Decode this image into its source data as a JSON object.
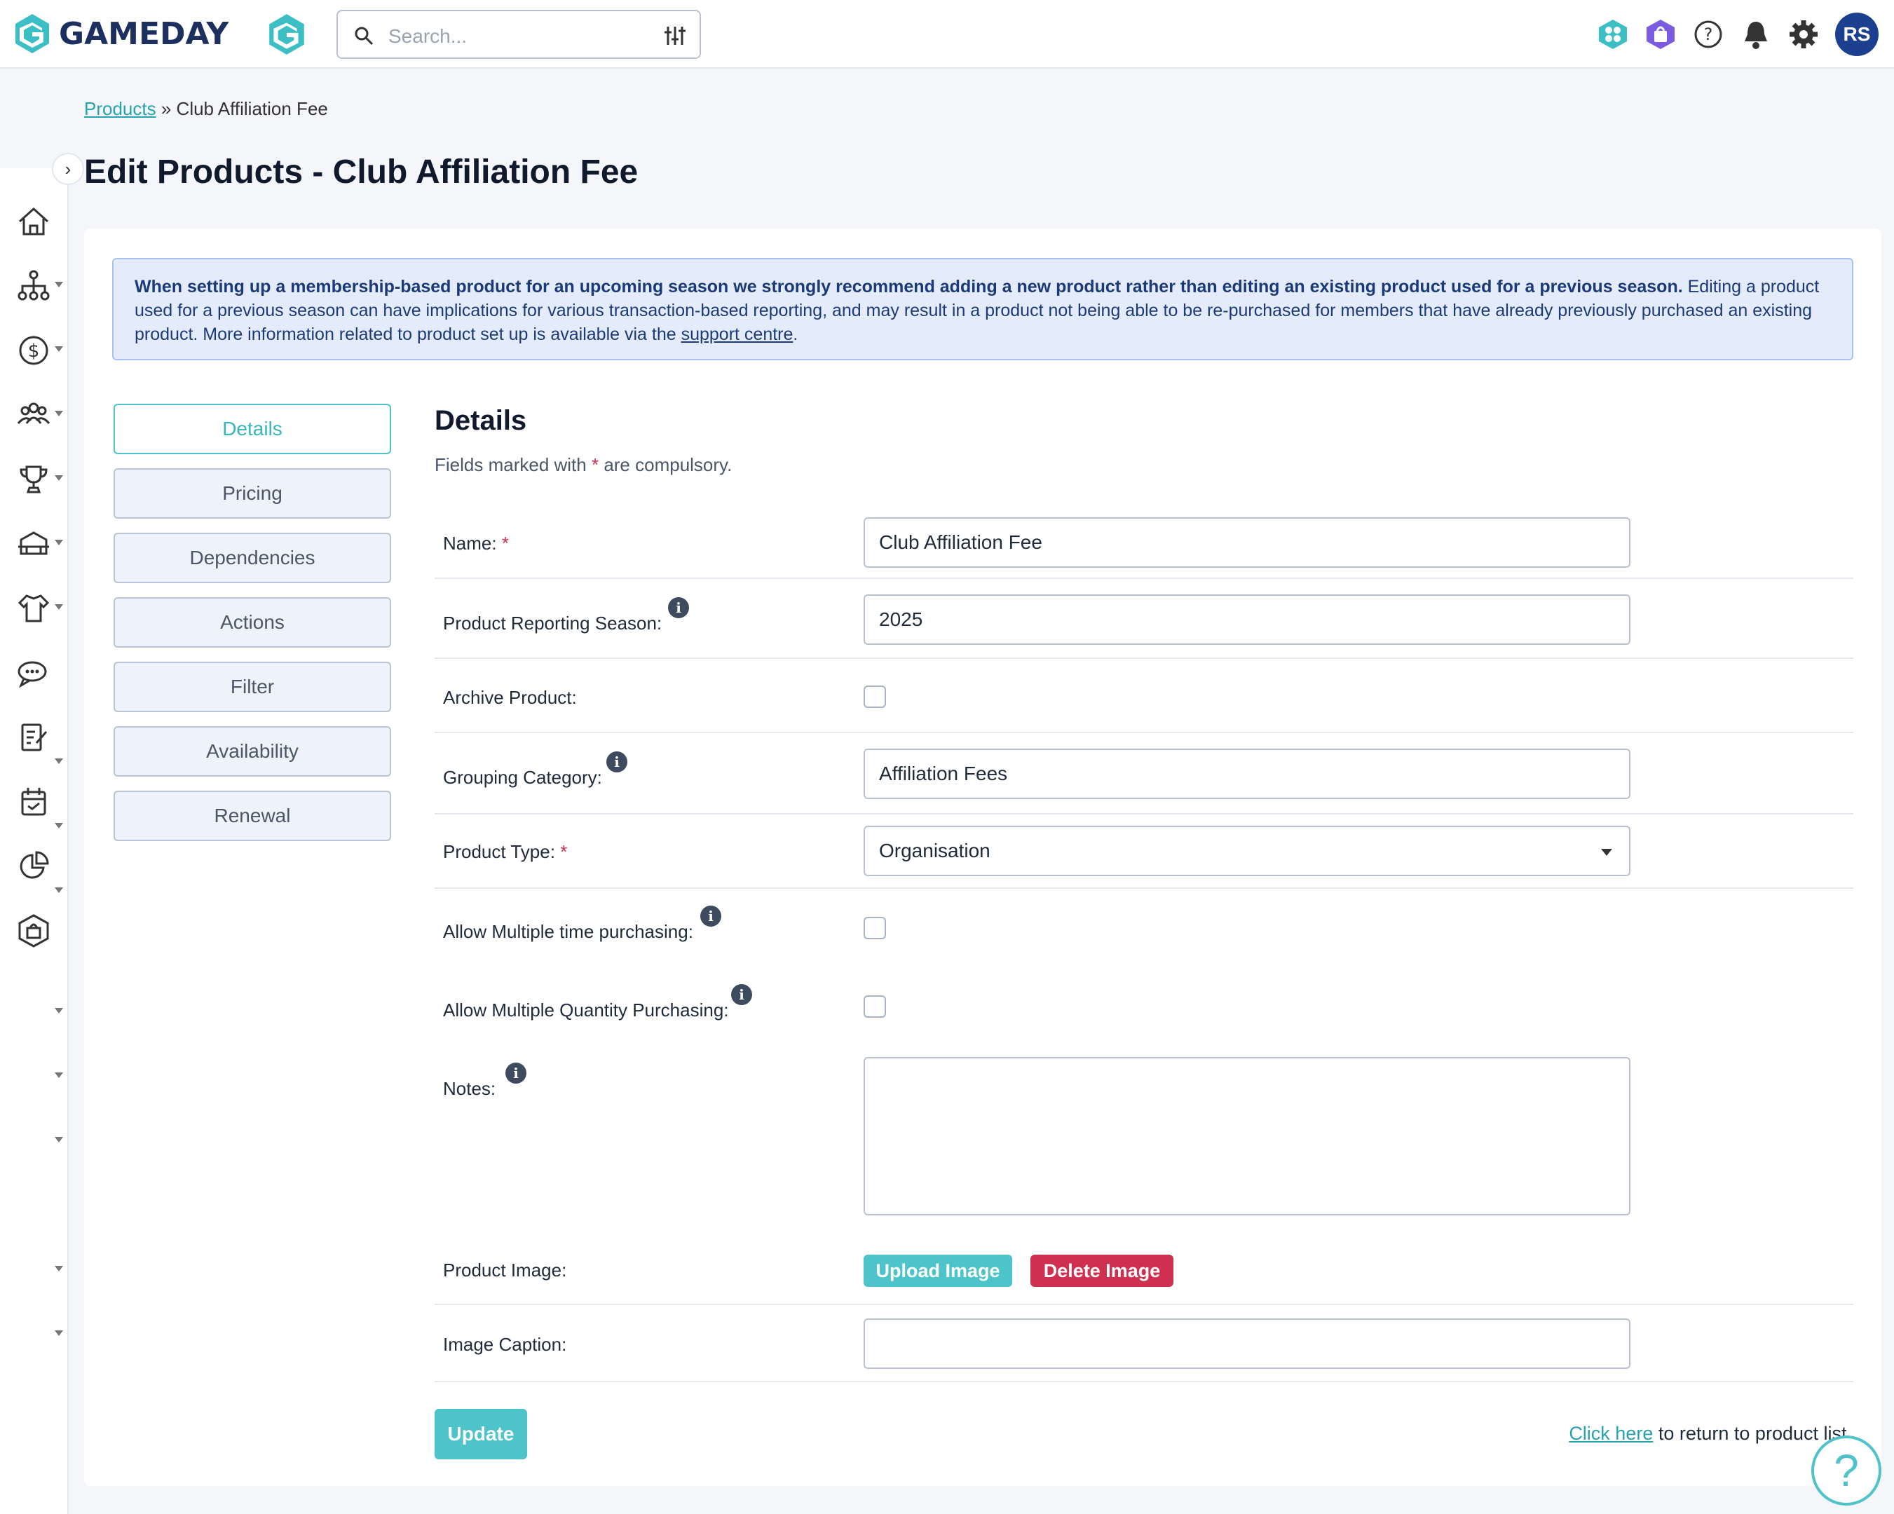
{
  "app": {
    "brand": "GAMEDAY"
  },
  "search": {
    "placeholder": "Search..."
  },
  "user": {
    "initials": "RS"
  },
  "colors": {
    "accent": "#4cc4c9",
    "brand": "#1d2f5e",
    "danger": "#d0304f",
    "alert_bg": "#e4ecfb"
  },
  "breadcrumb": {
    "parent": "Products",
    "separator": "»",
    "current": "Club Affiliation Fee"
  },
  "page": {
    "title": "Edit Products - Club Affiliation Fee"
  },
  "alert": {
    "bold": "When setting up a membership-based product for an upcoming season we strongly recommend adding a new product rather than editing an existing product used for a previous season.",
    "text": " Editing a product used for a previous season can have implications for various transaction-based reporting, and may result in a product not being able to be re-purchased for members that have already previously purchased an existing product. More information related to product set up is available via the ",
    "link": "support centre",
    "end": "."
  },
  "tabs": [
    {
      "label": "Details",
      "active": true
    },
    {
      "label": "Pricing"
    },
    {
      "label": "Dependencies"
    },
    {
      "label": "Actions"
    },
    {
      "label": "Filter"
    },
    {
      "label": "Availability"
    },
    {
      "label": "Renewal"
    }
  ],
  "form": {
    "title": "Details",
    "subtitle_pre": "Fields marked with ",
    "required_mark": "*",
    "subtitle_post": " are compulsory.",
    "name_label": "Name:",
    "name_value": "Club Affiliation Fee",
    "season_label": "Product Reporting Season:",
    "season_value": "2025",
    "archive_label": "Archive Product:",
    "grouping_label": "Grouping Category:",
    "grouping_value": "Affiliation Fees",
    "type_label": "Product Type:",
    "type_value": "Organisation",
    "multi_time_label": "Allow Multiple time purchasing:",
    "multi_qty_label": "Allow Multiple Quantity Purchasing:",
    "notes_label": "Notes:",
    "image_label": "Product Image:",
    "upload_label": "Upload Image",
    "delete_label": "Delete Image",
    "caption_label": "Image Caption:",
    "info_glyph": "i"
  },
  "footer": {
    "update_label": "Update",
    "return_link": "Click here",
    "return_text": " to return to product list."
  },
  "help": {
    "glyph": "?"
  },
  "sidebar": {
    "collapse_glyph": "›"
  }
}
